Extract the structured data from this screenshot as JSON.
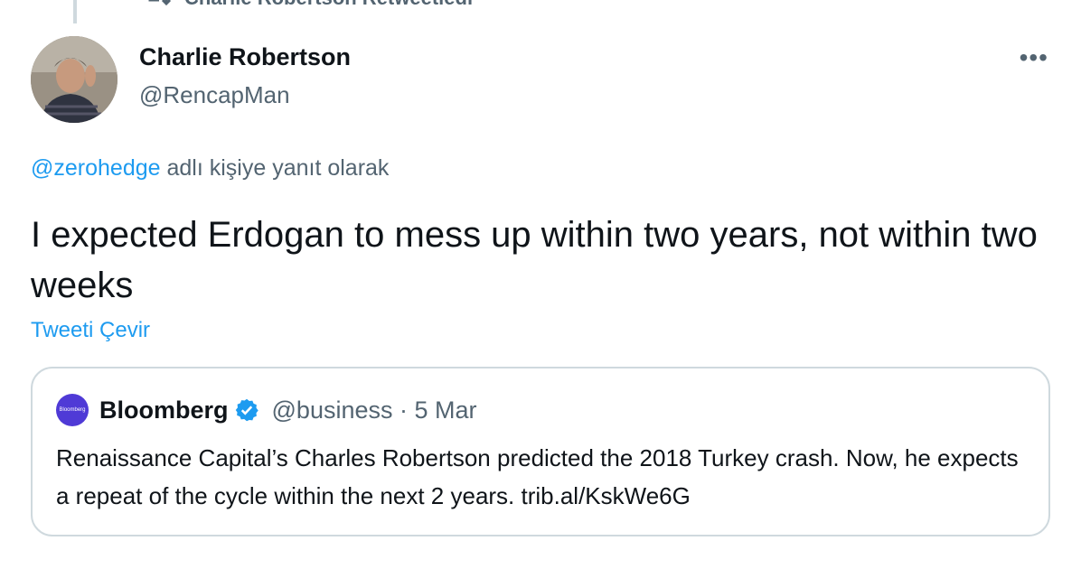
{
  "retweet_context": {
    "label": "Charlie Robertson Retweetledi"
  },
  "tweet": {
    "author": {
      "name": "Charlie Robertson",
      "handle": "@RencapMan"
    },
    "reply_prefix": "@zerohedge",
    "reply_suffix": " adlı kişiye yanıt olarak",
    "text": "I expected Erdogan to mess up within two years, not within two weeks",
    "translate_label": "Tweeti Çevir",
    "more_label": "•••"
  },
  "quote": {
    "avatar_text": "Bloomberg",
    "author_name": "Bloomberg",
    "handle_date": "@business · 5 Mar",
    "text": "Renaissance Capital’s Charles Robertson predicted the 2018 Turkey crash. Now, he expects a repeat of the cycle within the next 2 years. trib.al/KskWe6G"
  },
  "colors": {
    "link": "#1d9bf0",
    "secondary": "#536471",
    "verified": "#1d9bf0",
    "bloomberg": "#4f3ad6"
  },
  "icons": {
    "retweet": "retweet-icon",
    "verified": "verified-badge-icon",
    "more": "more-icon"
  }
}
